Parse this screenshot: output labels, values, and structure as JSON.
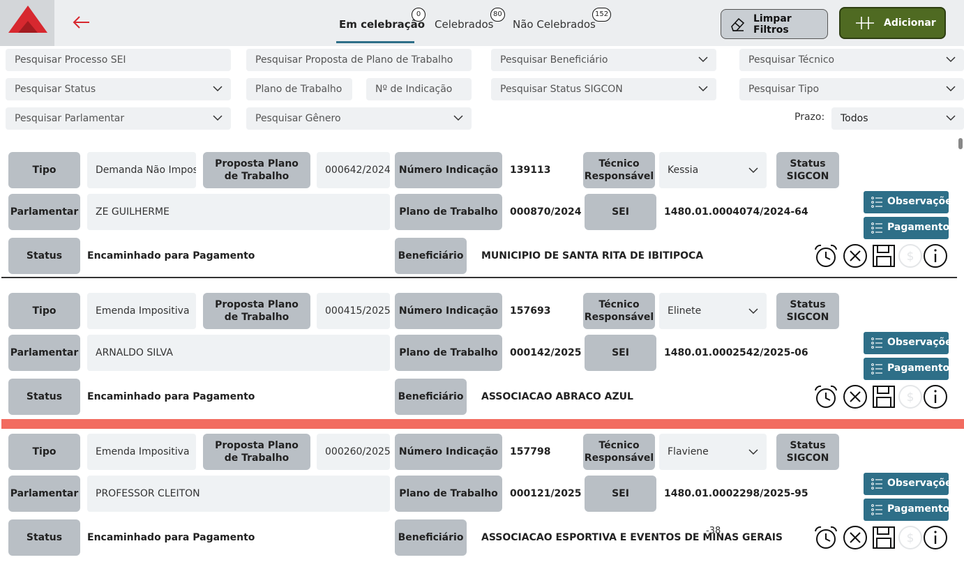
{
  "header": {
    "tabs": [
      {
        "label": "Em celebração",
        "count": "0",
        "active": true
      },
      {
        "label": "Celebrados",
        "count": "80",
        "active": false
      },
      {
        "label": "Não Celebrados",
        "count": "152",
        "active": false
      }
    ],
    "clear_filters_label": "Limpar Filtros",
    "add_label": "Adicionar"
  },
  "filters": {
    "processo_sei": "Pesquisar Processo SEI",
    "proposta_plano": "Pesquisar Proposta de Plano de Trabalho",
    "beneficiario": "Pesquisar Beneficiário",
    "tecnico": "Pesquisar Técnico",
    "status": "Pesquisar Status",
    "plano_trabalho": "Plano de Trabalho",
    "indicacao": "Nº de Indicação",
    "status_sigcon": "Pesquisar Status SIGCON",
    "tipo": "Pesquisar Tipo",
    "parlamentar": "Pesquisar Parlamentar",
    "genero": "Pesquisar Gênero",
    "prazo_label": "Prazo:",
    "prazo_value": "Todos"
  },
  "labels": {
    "tipo": "Tipo",
    "proposta": "Proposta Plano de Trabalho",
    "numero_indicacao": "Número Indicação",
    "tecnico": "Técnico Responsável",
    "status_sigcon": "Status SIGCON",
    "parlamentar": "Parlamentar",
    "plano_trabalho": "Plano de Trabalho",
    "sei": "SEI",
    "status": "Status",
    "beneficiario": "Beneficiário",
    "observacoes": "Observações",
    "pagamento": "Pagamento"
  },
  "records": [
    {
      "tipo": "Demanda Não Impositiva",
      "proposta": "000642/2024",
      "numero_indicacao": "139113",
      "tecnico": "Kessia",
      "parlamentar": "ZE GUILHERME",
      "plano_trabalho": "000870/2024",
      "sei": "1480.01.0004074/2024-64",
      "status": "Encaminhado para Pagamento",
      "beneficiario": "MUNICIPIO DE SANTA RITA DE IBITIPOCA"
    },
    {
      "tipo": "Emenda Impositiva",
      "proposta": "000415/2025",
      "numero_indicacao": "157693",
      "tecnico": "Elinete",
      "parlamentar": "ARNALDO SILVA",
      "plano_trabalho": "000142/2025",
      "sei": "1480.01.0002542/2025-06",
      "status": "Encaminhado para Pagamento",
      "beneficiario": "ASSOCIACAO ABRACO AZUL"
    },
    {
      "tipo": "Emenda Impositiva",
      "proposta": "000260/2025",
      "numero_indicacao": "157798",
      "tecnico": "Flaviene",
      "parlamentar": "PROFESSOR CLEITON",
      "plano_trabalho": "000121/2025",
      "sei": "1480.01.0002298/2025-95",
      "status": "Encaminhado para Pagamento",
      "beneficiario": "ASSOCIACAO ESPORTIVA E EVENTOS DE MINAS GERAIS"
    }
  ],
  "page_indicator": "-38",
  "colors": {
    "accent": "#2e6f88",
    "add_button": "#4f6a22",
    "alert_row": "#f26b60",
    "logo": "#d7282f"
  }
}
